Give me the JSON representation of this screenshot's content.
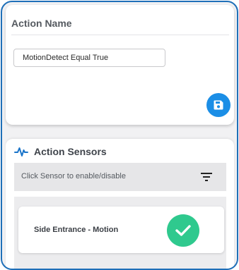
{
  "action_card": {
    "title": "Action Name",
    "name_value": "MotionDetect Equal True",
    "save_icon": "floppy-disk-icon"
  },
  "sensors_card": {
    "title": "Action Sensors",
    "header_icon": "heartbeat-pulse-icon",
    "filter_hint": "Click Sensor to enable/disable",
    "filter_icon": "filter-lines-icon",
    "sensors": [
      {
        "label": "Side Entrance - Motion",
        "enabled": true,
        "status_icon": "check-circle-icon"
      }
    ]
  },
  "colors": {
    "frame_border": "#1e6fb8",
    "save_button": "#1b8ee6",
    "pulse_accent": "#1a74c9",
    "enabled_green": "#2fc98e"
  }
}
